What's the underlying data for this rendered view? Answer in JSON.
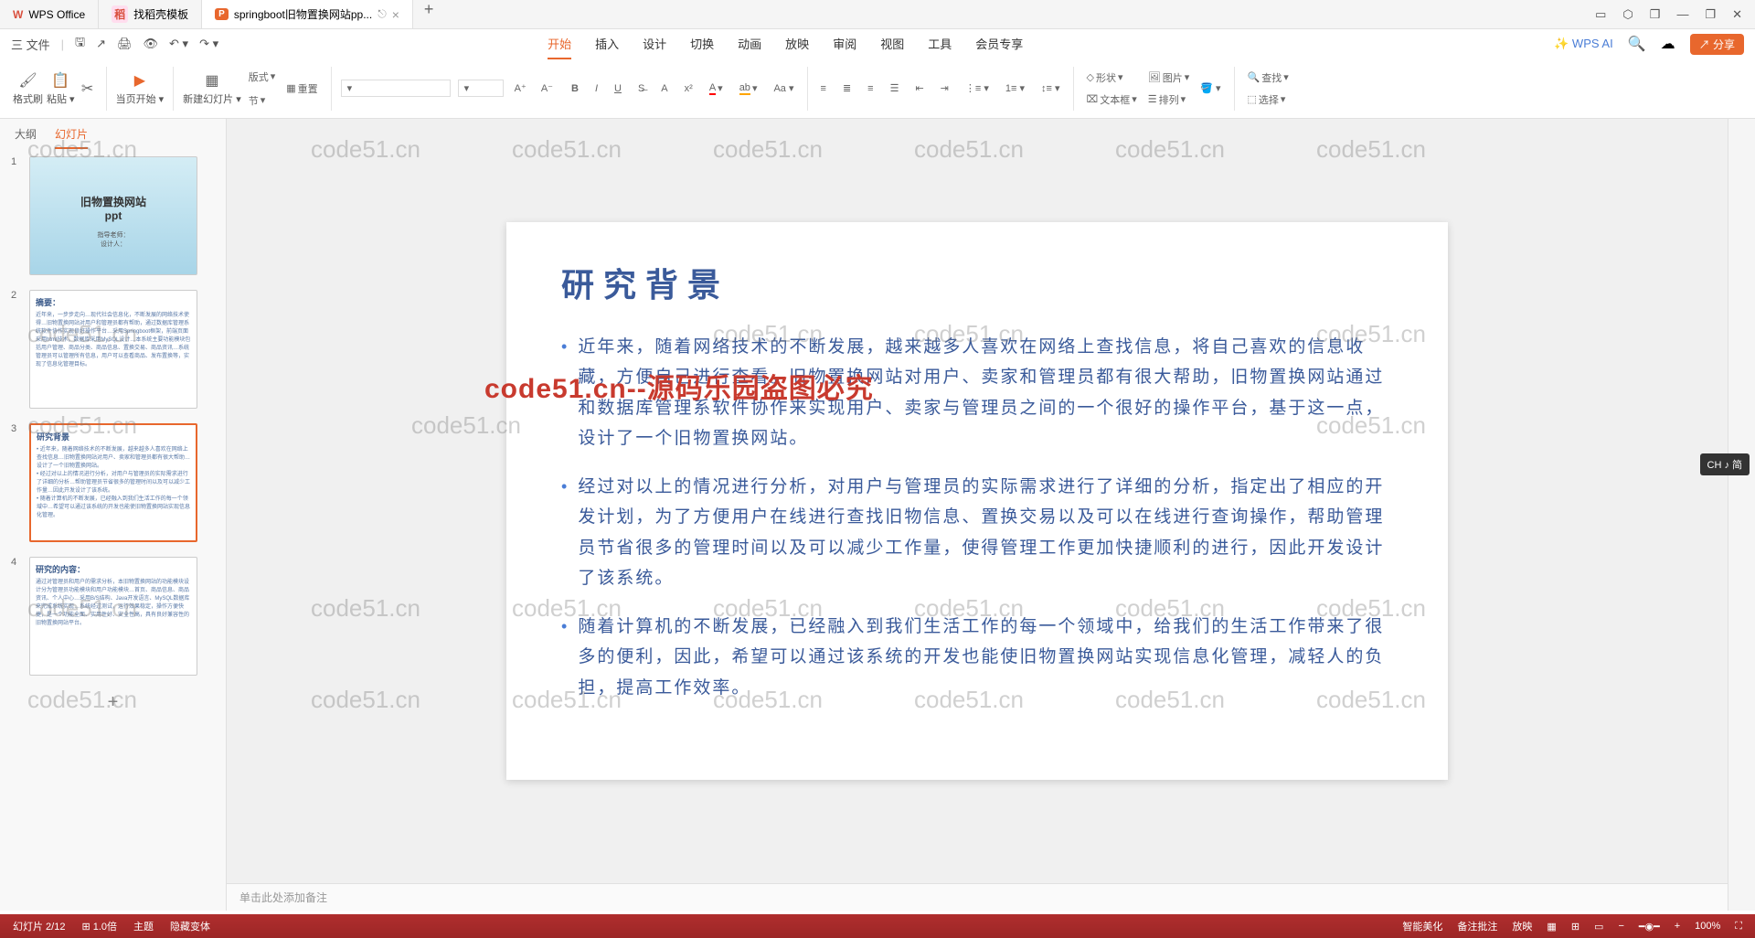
{
  "title_bar": {
    "tabs": [
      {
        "icon": "W",
        "label": "WPS Office"
      },
      {
        "icon": "稻",
        "label": "找稻壳模板"
      },
      {
        "icon": "P",
        "label": "springboot旧物置换网站pp..."
      }
    ],
    "close": "×",
    "add": "+"
  },
  "menu": {
    "file": "三 文件",
    "tabs": [
      "开始",
      "插入",
      "设计",
      "切换",
      "动画",
      "放映",
      "审阅",
      "视图",
      "工具",
      "会员专享"
    ],
    "active_tab": "开始",
    "wps_ai": "WPS AI",
    "share": "分享"
  },
  "ribbon": {
    "format_painter": "格式刷",
    "paste": "粘贴",
    "current_start": "当页开始",
    "new_slide": "新建幻灯片",
    "layout": "版式",
    "section": "节",
    "reset": "重置",
    "shape": "形状",
    "picture": "图片",
    "textbox": "文本框",
    "arrange": "排列",
    "find": "查找",
    "select": "选择"
  },
  "slide_panel": {
    "tabs": [
      "大纲",
      "幻灯片"
    ],
    "active": "幻灯片",
    "slides": [
      {
        "num": "1",
        "title": "旧物置换网站\nppt",
        "sub1": "指导老师：",
        "sub2": "设计人："
      },
      {
        "num": "2",
        "title": "摘要："
      },
      {
        "num": "3",
        "title": "研究背景"
      },
      {
        "num": "4",
        "title": "研究的内容："
      }
    ],
    "add": "+"
  },
  "slide_content": {
    "title": "研究背景",
    "bullets": [
      "近年来，随着网络技术的不断发展，越来越多人喜欢在网络上查找信息，将自己喜欢的信息收藏，方便自己进行查看。旧物置换网站对用户、卖家和管理员都有很大帮助，旧物置换网站通过和数据库管理系软件协作来实现用户、卖家与管理员之间的一个很好的操作平台，基于这一点，设计了一个旧物置换网站。",
      "经过对以上的情况进行分析，对用户与管理员的实际需求进行了详细的分析，指定出了相应的开发计划，为了方便用户在线进行查找旧物信息、置换交易以及可以在线进行查询操作，帮助管理员节省很多的管理时间以及可以减少工作量，使得管理工作更加快捷顺利的进行，因此开发设计了该系统。",
      "随着计算机的不断发展，已经融入到我们生活工作的每一个领域中，给我们的生活工作带来了很多的便利，因此，希望可以通过该系统的开发也能使旧物置换网站实现信息化管理，减轻人的负担，提高工作效率。"
    ]
  },
  "notes": "单击此处添加备注",
  "watermark": "code51.cn",
  "watermark_red": "code51.cn--源码乐园盗图必究",
  "ime": "CH ♪ 简",
  "status": {
    "left": [
      "幻灯片 2/12",
      "⊞ 1.0倍",
      "主题",
      "隐藏变体"
    ],
    "right": [
      "智能美化",
      "备注批注",
      "放映",
      "100%"
    ]
  }
}
